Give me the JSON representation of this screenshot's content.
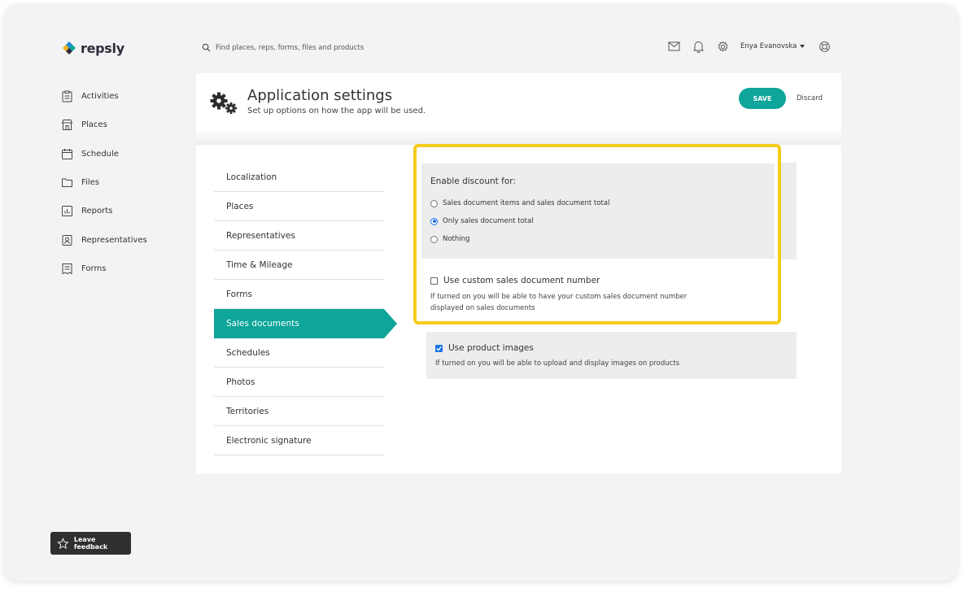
{
  "app": {
    "logo_text": "repsly"
  },
  "search": {
    "placeholder": "Find places, reps, forms, files and products"
  },
  "header": {
    "user_name": "Enya Evanovska"
  },
  "sidebar": {
    "items": [
      {
        "label": "Activities",
        "icon": "clipboard-icon"
      },
      {
        "label": "Places",
        "icon": "store-icon"
      },
      {
        "label": "Schedule",
        "icon": "calendar-icon"
      },
      {
        "label": "Files",
        "icon": "folder-icon"
      },
      {
        "label": "Reports",
        "icon": "bar-chart-icon"
      },
      {
        "label": "Representatives",
        "icon": "person-badge-icon"
      },
      {
        "label": "Forms",
        "icon": "form-icon"
      }
    ]
  },
  "feedback": {
    "label": "Leave feedback"
  },
  "page": {
    "title": "Application settings",
    "subtitle": "Set up options on how the app will be used.",
    "save_label": "SAVE",
    "discard_label": "Discard"
  },
  "settings_nav": {
    "items": [
      "Localization",
      "Places",
      "Representatives",
      "Time & Mileage",
      "Forms",
      "Sales documents",
      "Schedules",
      "Photos",
      "Territories",
      "Electronic signature"
    ],
    "active": "Sales documents"
  },
  "discount": {
    "label": "Enable discount for:",
    "options": [
      "Sales document items and sales document total",
      "Only sales document total",
      "Nothing"
    ],
    "selected": "Only sales document total"
  },
  "custom_number": {
    "label": "Use custom sales document number",
    "checked": false,
    "help_line1": "If turned on you will be able to have your custom sales document number",
    "help_line2": "displayed on sales documents"
  },
  "product_images": {
    "label": "Use product images",
    "checked": true,
    "help": "If turned on you will be able to upload and display images on products"
  },
  "colors": {
    "accent": "#0ea59a",
    "highlight": "#f6cc1a",
    "checkbox": "#1a73e8"
  }
}
